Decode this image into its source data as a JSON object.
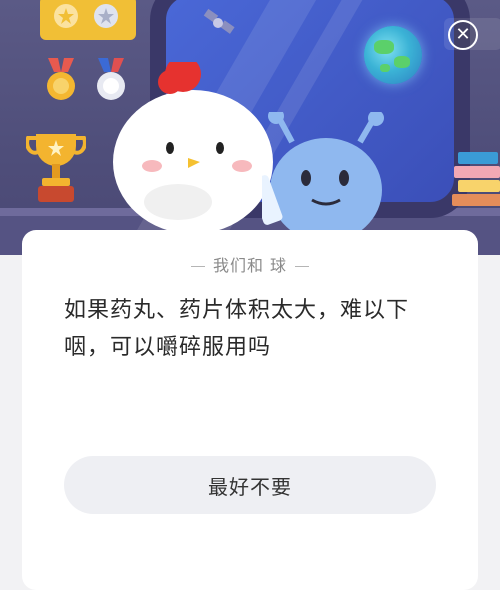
{
  "colors": {
    "scene_bg": "#5b5a86",
    "window_glass": "#4a68d7",
    "card_bg": "#ffffff",
    "answer_bg": "#eeeff3",
    "medal_box": "#f1bf36"
  },
  "icons": {
    "close": "close-icon",
    "globe": "globe-icon",
    "trophy": "trophy-icon",
    "satellite": "satellite-icon"
  },
  "close_glyph": "✕",
  "card": {
    "source_label": "我们和 球",
    "question": "如果药丸、药片体积太大，难以下咽，可以嚼碎服用吗",
    "answer_label": "最好不要"
  }
}
